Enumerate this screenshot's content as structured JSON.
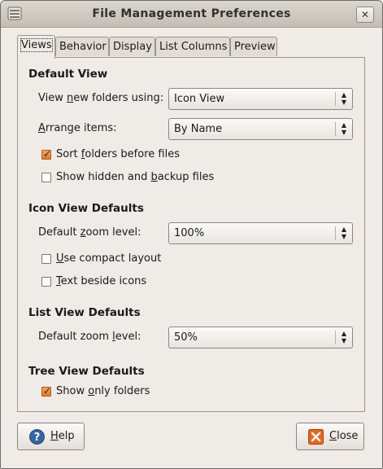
{
  "window": {
    "title": "File Management Preferences",
    "close_glyph": "✕"
  },
  "tabs": [
    {
      "label": "Views",
      "active": true
    },
    {
      "label": "Behavior",
      "active": false
    },
    {
      "label": "Display",
      "active": false
    },
    {
      "label": "List Columns",
      "active": false
    },
    {
      "label": "Preview",
      "active": false
    }
  ],
  "default_view": {
    "heading": "Default View",
    "view_new_label_pre": "View ",
    "view_new_label_u": "n",
    "view_new_label_post": "ew folders using:",
    "view_new_value": "Icon View",
    "arrange_label_u": "A",
    "arrange_label_post": "rrange items:",
    "arrange_value": "By Name",
    "sort_folders": {
      "pre": "Sort ",
      "u": "f",
      "post": "olders before files",
      "checked": true
    },
    "show_hidden": {
      "pre": "Show hidden and ",
      "u": "b",
      "post": "ackup files",
      "checked": false
    }
  },
  "icon_view": {
    "heading": "Icon View Defaults",
    "zoom_label_pre": "Default ",
    "zoom_label_u": "z",
    "zoom_label_post": "oom level:",
    "zoom_value": "100%",
    "compact": {
      "pre": "",
      "u": "U",
      "post": "se compact layout",
      "checked": false
    },
    "text_beside": {
      "pre": "",
      "u": "T",
      "post": "ext beside icons",
      "checked": false
    }
  },
  "list_view": {
    "heading": "List View Defaults",
    "zoom_label_pre": "Default zoom ",
    "zoom_label_u": "l",
    "zoom_label_post": "evel:",
    "zoom_value": "50%"
  },
  "tree_view": {
    "heading": "Tree View Defaults",
    "only_folders": {
      "pre": "Show ",
      "u": "o",
      "post": "nly folders",
      "checked": true
    }
  },
  "buttons": {
    "help": {
      "u": "H",
      "post": "elp"
    },
    "close": {
      "u": "C",
      "post": "lose"
    }
  },
  "colors": {
    "accent": "#e07a26",
    "help_icon": "#3465a4",
    "close_icon": "#e8671b"
  }
}
